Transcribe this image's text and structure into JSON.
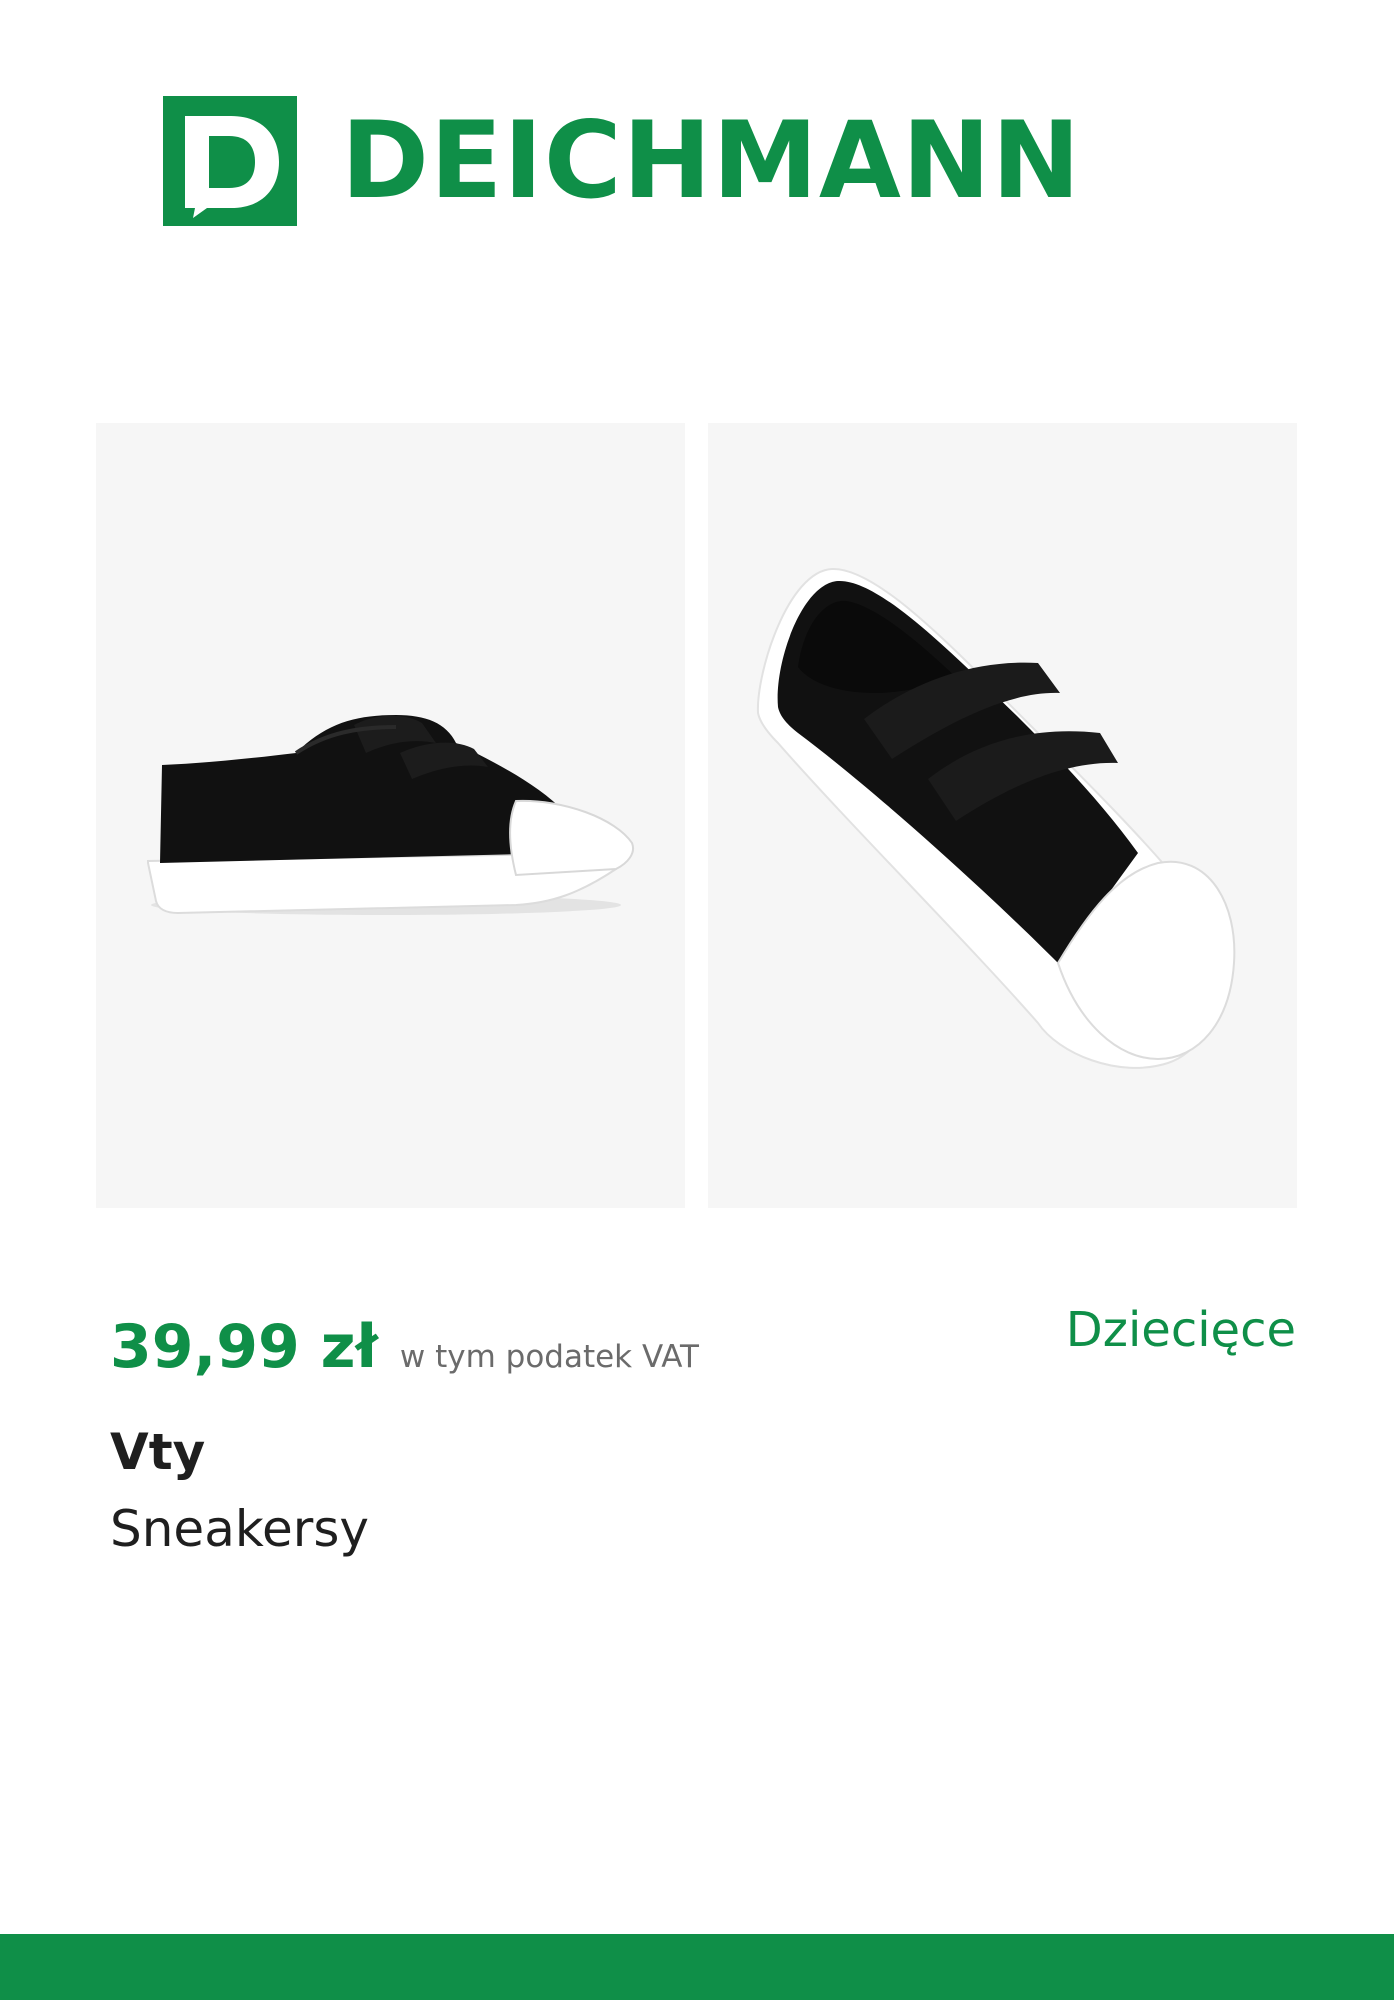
{
  "brand_logo": {
    "wordmark": "DEICHMANN",
    "mark_letter": "D",
    "color": "#0f8f48"
  },
  "gallery": {
    "images": [
      {
        "alt": "black-velcro-sneaker-side-view"
      },
      {
        "alt": "black-velcro-sneaker-angled-view"
      }
    ]
  },
  "product": {
    "price": "39,99 zł",
    "vat_note": "w tym podatek VAT",
    "category": "Dziecięce",
    "brand": "Vty",
    "type": "Sneakersy"
  },
  "colors": {
    "accent": "#0f8f48",
    "photo_background": "#f6f6f6"
  }
}
